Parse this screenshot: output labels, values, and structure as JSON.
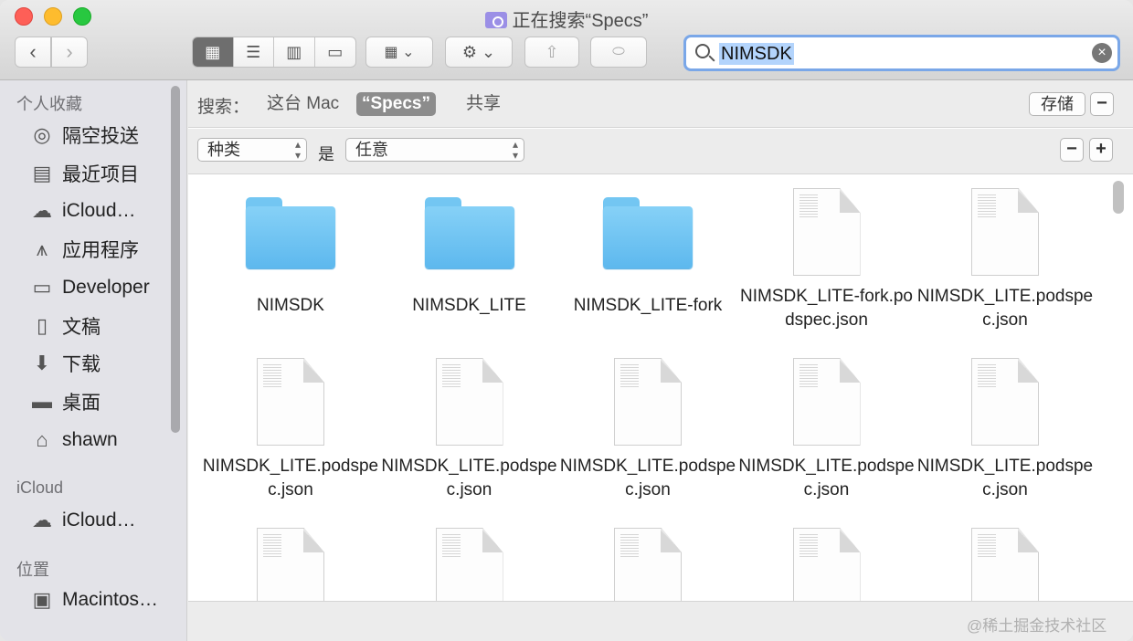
{
  "window": {
    "title": "正在搜索“Specs”"
  },
  "toolbar": {
    "back_label": "‹",
    "forward_label": "›",
    "search_query": "NIMSDK"
  },
  "sidebar": {
    "favorites_header": "个人收藏",
    "favorites": [
      {
        "label": "隔空投送",
        "icon": "airdrop-icon"
      },
      {
        "label": "最近项目",
        "icon": "recents-icon"
      },
      {
        "label": "iCloud…",
        "icon": "cloud-icon"
      },
      {
        "label": "应用程序",
        "icon": "applications-icon"
      },
      {
        "label": "Developer",
        "icon": "folder-icon"
      },
      {
        "label": "文稿",
        "icon": "documents-icon"
      },
      {
        "label": "下载",
        "icon": "downloads-icon"
      },
      {
        "label": "桌面",
        "icon": "desktop-icon"
      },
      {
        "label": "shawn",
        "icon": "home-icon"
      }
    ],
    "icloud_header": "iCloud",
    "icloud_items": [
      {
        "label": "iCloud…",
        "icon": "cloud-icon"
      }
    ],
    "locations_header": "位置",
    "locations": [
      {
        "label": "Macintos…",
        "icon": "disk-icon"
      }
    ]
  },
  "scopebar": {
    "label": "搜索：",
    "scopes": [
      "这台 Mac",
      "“Specs”",
      "共享"
    ],
    "save_label": "存储",
    "minus": "−"
  },
  "rulebar": {
    "attribute": "种类",
    "operator": "是",
    "value": "任意",
    "minus": "−",
    "plus": "+"
  },
  "files": [
    {
      "name": "NIMSDK",
      "kind": "folder"
    },
    {
      "name": "NIMSDK_LITE",
      "kind": "folder"
    },
    {
      "name": "NIMSDK_LITE-fork",
      "kind": "folder"
    },
    {
      "name": "NIMSDK_LITE-fork.podspec.json",
      "kind": "document"
    },
    {
      "name": "NIMSDK_LITE.podspec.json",
      "kind": "document"
    },
    {
      "name": "NIMSDK_LITE.podspec.json",
      "kind": "document"
    },
    {
      "name": "NIMSDK_LITE.podspec.json",
      "kind": "document"
    },
    {
      "name": "NIMSDK_LITE.podspec.json",
      "kind": "document"
    },
    {
      "name": "NIMSDK_LITE.podspec.json",
      "kind": "document"
    },
    {
      "name": "NIMSDK_LITE.podspec.json",
      "kind": "document"
    },
    {
      "name": "",
      "kind": "document"
    },
    {
      "name": "",
      "kind": "document"
    },
    {
      "name": "",
      "kind": "document"
    },
    {
      "name": "",
      "kind": "document"
    },
    {
      "name": "",
      "kind": "document"
    }
  ],
  "watermark": "@稀土掘金技术社区"
}
